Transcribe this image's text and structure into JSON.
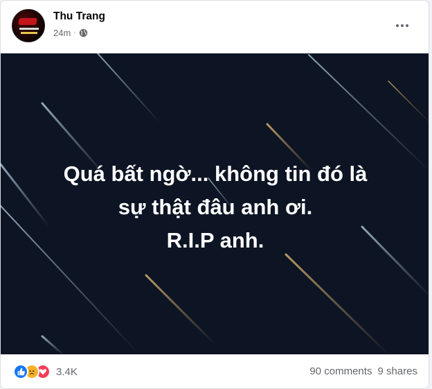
{
  "post": {
    "author": "Thu Trang",
    "time": "24m",
    "separator": "·",
    "privacy_icon": "globe-icon",
    "more_icon": "more-options-icon",
    "text_lines": [
      "Quá bất ngờ... không tin đó là",
      "sự thật đâu anh ơi.",
      "R.I.P anh."
    ],
    "background": {
      "color": "#0d1423",
      "theme": "meteor-shower"
    }
  },
  "footer": {
    "reactions": [
      "like-icon",
      "sad-icon",
      "love-icon"
    ],
    "reaction_count": "3.4K",
    "comments": "90 comments",
    "shares": "9 shares"
  },
  "colors": {
    "like": "#1877f2",
    "sad": "#f7b125",
    "love": "#f33e58",
    "meta_text": "#65676b"
  }
}
